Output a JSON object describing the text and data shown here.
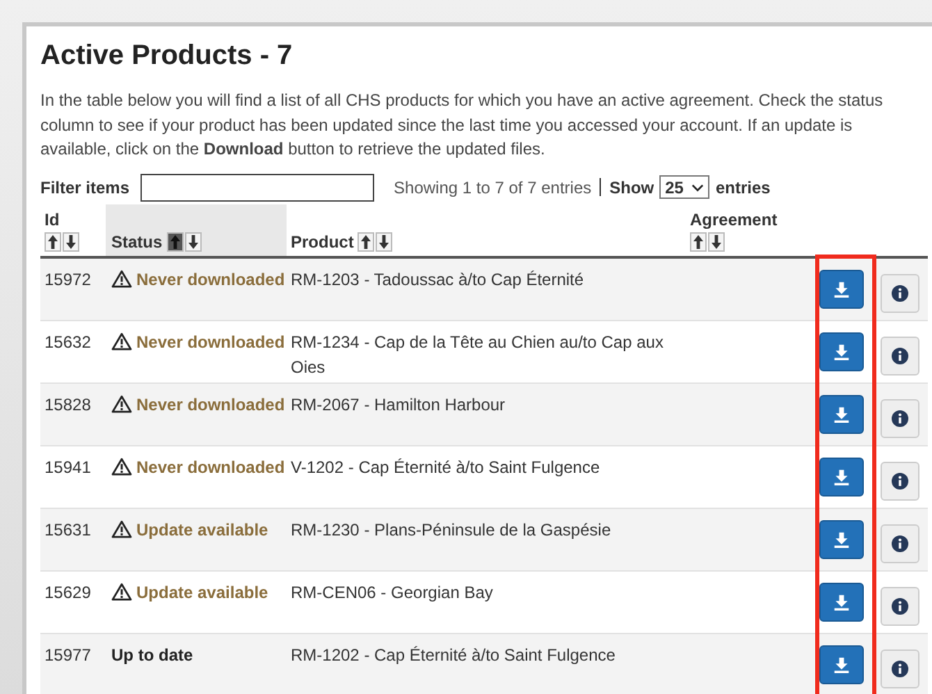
{
  "title": "Active Products - 7",
  "intro": "In the table below you will find a list of all CHS products for which you have an active agreement. Check the status column to see if your product has been updated since the last time you accessed your account. If an update is available, click on the **Download** button to retrieve the updated files.",
  "filter": {
    "label": "Filter items"
  },
  "entries_info": "Showing 1 to 7 of 7 entries",
  "show": {
    "label": "Show",
    "value": "25",
    "suffix": "entries"
  },
  "columns": [
    {
      "label": "Id",
      "sorted": false
    },
    {
      "label": "Status",
      "sorted": true
    },
    {
      "label": "Product",
      "sorted": false
    },
    {
      "label": "Agreement",
      "sorted": false
    }
  ],
  "rows": [
    {
      "id": "15972",
      "status": "Never downloaded",
      "kind": "warning",
      "product": "RM-1203 - Tadoussac à/to Cap Éternité"
    },
    {
      "id": "15632",
      "status": "Never downloaded",
      "kind": "warning",
      "product": "RM-1234 - Cap de la Tête au Chien au/to Cap aux Oies"
    },
    {
      "id": "15828",
      "status": "Never downloaded",
      "kind": "warning",
      "product": "RM-2067 - Hamilton Harbour"
    },
    {
      "id": "15941",
      "status": "Never downloaded",
      "kind": "warning",
      "product": "V-1202 - Cap Éternité à/to Saint Fulgence"
    },
    {
      "id": "15631",
      "status": "Update available",
      "kind": "warning",
      "product": "RM-1230 - Plans-Péninsule de la Gaspésie"
    },
    {
      "id": "15629",
      "status": "Update available",
      "kind": "warning",
      "product": "RM-CEN06 - Georgian Bay"
    },
    {
      "id": "15977",
      "status": "Up to date",
      "kind": "ok",
      "product": "RM-1202 - Cap Éternité à/to Saint Fulgence"
    }
  ],
  "download_column_highlighted": true
}
